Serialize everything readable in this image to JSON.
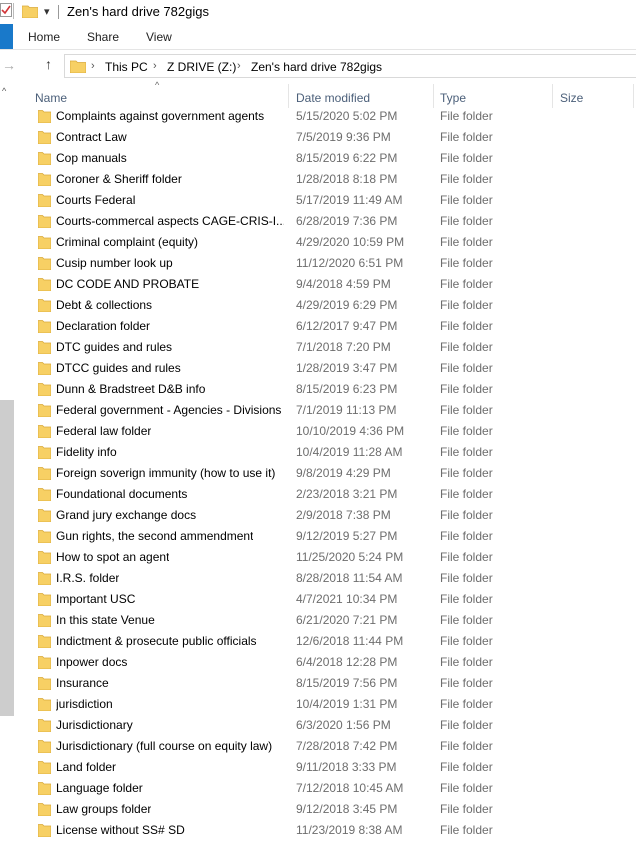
{
  "window": {
    "title": "Zen's hard drive 782gigs",
    "qa_dropdown": "▾"
  },
  "ribbon": {
    "tabs": [
      {
        "label": "Home"
      },
      {
        "label": "Share"
      },
      {
        "label": "View"
      }
    ]
  },
  "address": {
    "crumbs": [
      "This PC",
      "Z DRIVE (Z:)",
      "Zen's hard drive 782gigs"
    ],
    "separator": "›",
    "forward_glyph": "→",
    "up_glyph": "↑"
  },
  "columns": {
    "name": "Name",
    "date": "Date modified",
    "type": "Type",
    "size": "Size",
    "sort_glyph": "^"
  },
  "scroll": {
    "up_glyph": "^"
  },
  "folder_color": "#f7d064",
  "folders": [
    {
      "name": "Complaints against government agents",
      "date": "5/15/2020 5:02 PM",
      "type": "File folder"
    },
    {
      "name": "Contract Law",
      "date": "7/5/2019 9:36 PM",
      "type": "File folder"
    },
    {
      "name": "Cop manuals",
      "date": "8/15/2019 6:22 PM",
      "type": "File folder"
    },
    {
      "name": "Coroner & Sheriff folder",
      "date": "1/28/2018 8:18 PM",
      "type": "File folder"
    },
    {
      "name": "Courts Federal",
      "date": "5/17/2019 11:49 AM",
      "type": "File folder"
    },
    {
      "name": "Courts-commercal aspects CAGE-CRIS-I...",
      "date": "6/28/2019 7:36 PM",
      "type": "File folder"
    },
    {
      "name": "Criminal complaint (equity)",
      "date": "4/29/2020 10:59 PM",
      "type": "File folder"
    },
    {
      "name": "Cusip number look up",
      "date": "11/12/2020 6:51 PM",
      "type": "File folder"
    },
    {
      "name": "DC CODE AND PROBATE",
      "date": "9/4/2018 4:59 PM",
      "type": "File folder"
    },
    {
      "name": "Debt & collections",
      "date": "4/29/2019 6:29 PM",
      "type": "File folder"
    },
    {
      "name": "Declaration folder",
      "date": "6/12/2017 9:47 PM",
      "type": "File folder"
    },
    {
      "name": "DTC guides and rules",
      "date": "7/1/2018 7:20 PM",
      "type": "File folder"
    },
    {
      "name": "DTCC guides and rules",
      "date": "1/28/2019 3:47 PM",
      "type": "File folder"
    },
    {
      "name": "Dunn & Bradstreet D&B info",
      "date": "8/15/2019 6:23 PM",
      "type": "File folder"
    },
    {
      "name": "Federal government - Agencies - Divisions",
      "date": "7/1/2019 11:13 PM",
      "type": "File folder"
    },
    {
      "name": "Federal law folder",
      "date": "10/10/2019 4:36 PM",
      "type": "File folder"
    },
    {
      "name": "Fidelity info",
      "date": "10/4/2019 11:28 AM",
      "type": "File folder"
    },
    {
      "name": "Foreign soverign immunity (how to use it)",
      "date": "9/8/2019 4:29 PM",
      "type": "File folder"
    },
    {
      "name": "Foundational documents",
      "date": "2/23/2018 3:21 PM",
      "type": "File folder"
    },
    {
      "name": "Grand jury exchange docs",
      "date": "2/9/2018 7:38 PM",
      "type": "File folder"
    },
    {
      "name": "Gun rights, the second ammendment",
      "date": "9/12/2019 5:27 PM",
      "type": "File folder"
    },
    {
      "name": "How to spot an agent",
      "date": "11/25/2020 5:24 PM",
      "type": "File folder"
    },
    {
      "name": "I.R.S. folder",
      "date": "8/28/2018 11:54 AM",
      "type": "File folder"
    },
    {
      "name": "Important USC",
      "date": "4/7/2021 10:34 PM",
      "type": "File folder"
    },
    {
      "name": "In this state Venue",
      "date": "6/21/2020 7:21 PM",
      "type": "File folder"
    },
    {
      "name": "Indictment & prosecute public officials",
      "date": "12/6/2018 11:44 PM",
      "type": "File folder"
    },
    {
      "name": "Inpower docs",
      "date": "6/4/2018 12:28 PM",
      "type": "File folder"
    },
    {
      "name": "Insurance",
      "date": "8/15/2019 7:56 PM",
      "type": "File folder"
    },
    {
      "name": "jurisdiction",
      "date": "10/4/2019 1:31 PM",
      "type": "File folder"
    },
    {
      "name": "Jurisdictionary",
      "date": "6/3/2020 1:56 PM",
      "type": "File folder"
    },
    {
      "name": "Jurisdictionary (full course on equity law)",
      "date": "7/28/2018 7:42 PM",
      "type": "File folder"
    },
    {
      "name": "Land folder",
      "date": "9/11/2018 3:33 PM",
      "type": "File folder"
    },
    {
      "name": "Language folder",
      "date": "7/12/2018 10:45 AM",
      "type": "File folder"
    },
    {
      "name": "Law groups folder",
      "date": "9/12/2018 3:45 PM",
      "type": "File folder"
    },
    {
      "name": "License without SS# SD",
      "date": "11/23/2019 8:38 AM",
      "type": "File folder"
    }
  ]
}
